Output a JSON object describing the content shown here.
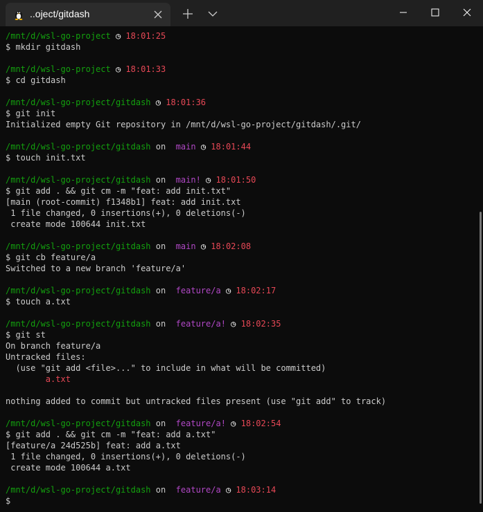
{
  "tab": {
    "title": "..oject/gitdash",
    "icon": "linux-penguin-icon"
  },
  "colors": {
    "background": "#0c0c0c",
    "titlebar": "#202020",
    "tab": "#2c2c2c",
    "text": "#cccccc",
    "path": "#13a10e",
    "branch": "#b148c6",
    "time": "#e74856"
  },
  "glyphs": {
    "on": "on",
    "git_icon": "",
    "clock_icon": "◷"
  },
  "terminal": {
    "blocks": [
      {
        "path": "/mnt/d/wsl-go-project",
        "branch": "",
        "time": "18:01:25",
        "command": "$ mkdir gitdash",
        "output": []
      },
      {
        "path": "/mnt/d/wsl-go-project",
        "branch": "",
        "time": "18:01:33",
        "command": "$ cd gitdash",
        "output": []
      },
      {
        "path": "/mnt/d/wsl-go-project/gitdash",
        "branch": "",
        "time": "18:01:36",
        "command": "$ git init",
        "output": [
          "Initialized empty Git repository in /mnt/d/wsl-go-project/gitdash/.git/"
        ]
      },
      {
        "path": "/mnt/d/wsl-go-project/gitdash",
        "branch": "main",
        "time": "18:01:44",
        "command": "$ touch init.txt",
        "output": []
      },
      {
        "path": "/mnt/d/wsl-go-project/gitdash",
        "branch": "main!",
        "time": "18:01:50",
        "command": "$ git add . && git cm -m \"feat: add init.txt\"",
        "output": [
          "[main (root-commit) f1348b1] feat: add init.txt",
          " 1 file changed, 0 insertions(+), 0 deletions(-)",
          " create mode 100644 init.txt"
        ]
      },
      {
        "path": "/mnt/d/wsl-go-project/gitdash",
        "branch": "main",
        "time": "18:02:08",
        "command": "$ git cb feature/a",
        "output": [
          "Switched to a new branch 'feature/a'"
        ]
      },
      {
        "path": "/mnt/d/wsl-go-project/gitdash",
        "branch": "feature/a",
        "time": "18:02:17",
        "command": "$ touch a.txt",
        "output": []
      },
      {
        "path": "/mnt/d/wsl-go-project/gitdash",
        "branch": "feature/a!",
        "time": "18:02:35",
        "command": "$ git st",
        "output": [
          "On branch feature/a",
          "Untracked files:",
          "  (use \"git add <file>...\" to include in what will be committed)",
          "        a.txt",
          "",
          "nothing added to commit but untracked files present (use \"git add\" to track)"
        ],
        "highlight_line": 3
      },
      {
        "path": "/mnt/d/wsl-go-project/gitdash",
        "branch": "feature/a!",
        "time": "18:02:54",
        "command": "$ git add . && git cm -m \"feat: add a.txt\"",
        "output": [
          "[feature/a 24d525b] feat: add a.txt",
          " 1 file changed, 0 insertions(+), 0 deletions(-)",
          " create mode 100644 a.txt"
        ]
      },
      {
        "path": "/mnt/d/wsl-go-project/gitdash",
        "branch": "feature/a",
        "time": "18:03:14",
        "command": "$ ",
        "output": []
      }
    ]
  }
}
